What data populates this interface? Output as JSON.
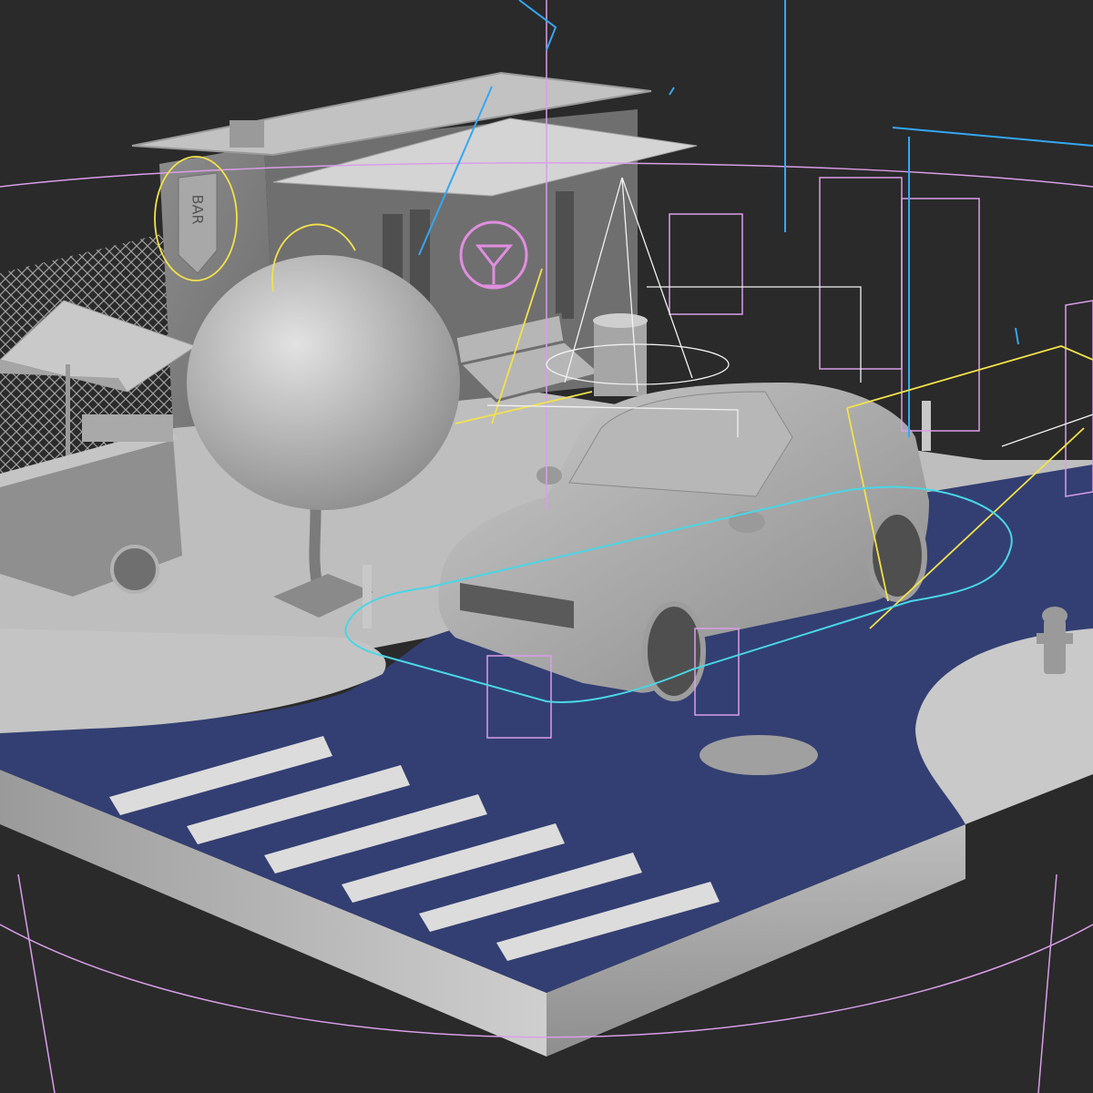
{
  "viewport": {
    "background": "#2a2a2a",
    "road_color": "#333f72",
    "surface_color": "#c8c8c8",
    "helper_colors": {
      "light_cyan": "#35a7f2",
      "camera_magenta": "#d99ee8",
      "light_yellow": "#f3e24a",
      "spline_cyan": "#49d6e6",
      "gizmo_white": "#f2f2f2"
    }
  },
  "scene": {
    "sign_text": "BAR",
    "crosswalk_stripes": 6,
    "objects": [
      "building",
      "awning",
      "bar-sign",
      "cocktail-neon-sign",
      "chain-link-fence",
      "umbrella",
      "food-cart",
      "tree",
      "bench",
      "trash-can",
      "suv-car",
      "fire-hydrant",
      "manhole",
      "crosswalk",
      "bollards"
    ]
  }
}
